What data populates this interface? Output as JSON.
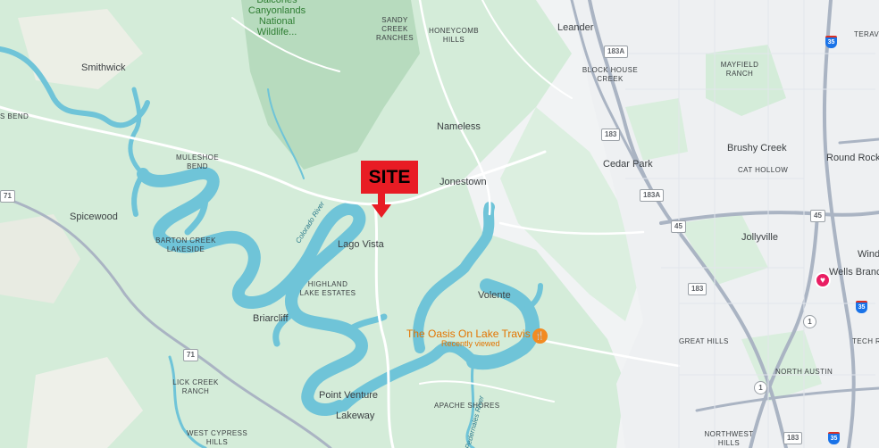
{
  "map": {
    "colors": {
      "land": "#f1f3f4",
      "green": "#d4ecd9",
      "dark_green": "#b7dbbe",
      "water": "#6fc4d8",
      "road": "#ffffff",
      "highway": "#aab4c3",
      "site_marker": "#e81c24"
    },
    "site_marker": {
      "label": "SITE"
    },
    "places": {
      "balcones": "Balcones Canyonlands National Wildlife...",
      "sandy_creek": "SANDY CREEK RANCHES",
      "honeycomb": "HONEYCOMB HILLS",
      "leander": "Leander",
      "teravista": "TERAV",
      "smithwick": "Smithwick",
      "block_house": "BLOCK HOUSE CREEK",
      "mayfield": "MAYFIELD RANCH",
      "s_bend": "S BEND",
      "nameless": "Nameless",
      "brushy_creek": "Brushy Creek",
      "muleshoe": "MULESHOE BEND",
      "cedar_park": "Cedar Park",
      "cat_hollow": "CAT HOLLOW",
      "round_rock": "Round Rock",
      "jonestown": "Jonestown",
      "spicewood": "Spicewood",
      "barton_creek": "BARTON CREEK LAKESIDE",
      "lago_vista": "Lago Vista",
      "jollyville": "Jollyville",
      "windy": "Wind",
      "wells_branch": "Wells Branch",
      "highland": "HIGHLAND LAKE ESTATES",
      "volente": "Volente",
      "briarcliff": "Briarcliff",
      "great_hills": "GREAT HILLS",
      "tech_ridge": "TECH R",
      "north_austin": "NORTH AUSTIN",
      "lick_creek": "LICK CREEK RANCH",
      "point_venture": "Point Venture",
      "apache_shores": "APACHE SHORES",
      "lakeway": "Lakeway",
      "west_cypress": "WEST CYPRESS HILLS",
      "northwest_hills": "NORTHWEST HILLS",
      "colorado_river": "Colorado River",
      "pedernales": "Pedernales River"
    },
    "poi": {
      "name": "The Oasis On Lake Travis",
      "subtitle": "Recently viewed",
      "icon": "restaurant-icon"
    },
    "favorite_icon": "heart-icon",
    "route_shields": {
      "r183a_top": "183A",
      "r183_a": "183",
      "r183a_mid": "183A",
      "r45": "45",
      "r183_b": "183",
      "r183_c": "183",
      "r71_left": "71",
      "r71_mid": "71",
      "i35_top": "35",
      "i35_mid": "35",
      "i35_bottom": "35",
      "loop1_a": "1",
      "loop1_b": "1"
    }
  }
}
